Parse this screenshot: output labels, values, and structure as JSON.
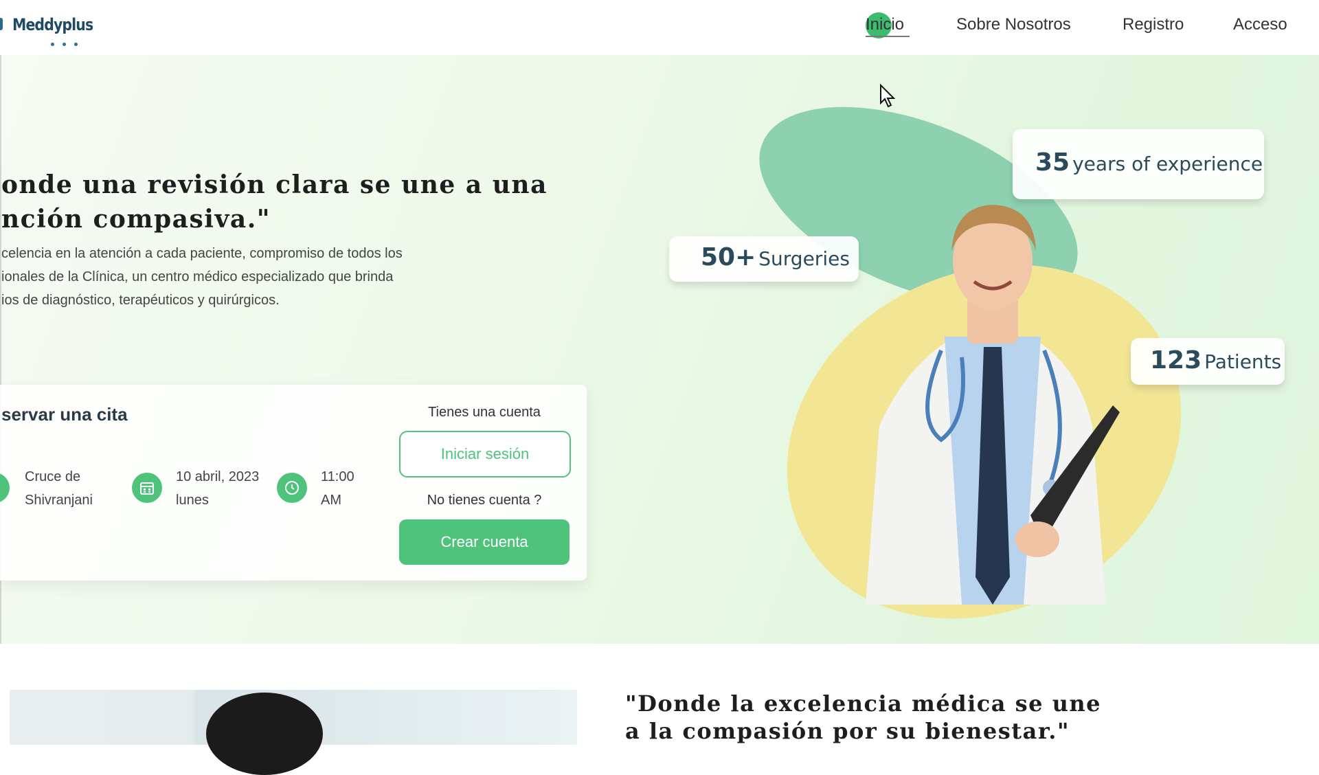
{
  "header": {
    "logo_text": "Meddyplus",
    "nav": [
      {
        "label": "Inicio",
        "active": true
      },
      {
        "label": "Sobre Nosotros"
      },
      {
        "label": "Registro"
      },
      {
        "label": "Acceso"
      }
    ]
  },
  "hero": {
    "title": "onde una revisión clara se une a una\nnción compasiva.\"",
    "description": "celencia en la atención a cada paciente, compromiso de todos los\nionales de la Clínica, un centro médico especializado que brinda\nios de diagnóstico, terapéuticos y quirúrgicos."
  },
  "appointment": {
    "title": "servar una cita",
    "location": "Cruce de\nShivranjani",
    "date": "10 abril, 2023\nlunes",
    "time": "11:00\nAM",
    "has_account_label": "Tienes una cuenta",
    "login_button": "Iniciar sesión",
    "no_account_label": "No tienes cuenta ?",
    "create_button": "Crear cuenta"
  },
  "stats": {
    "experience_number": "35",
    "experience_label": "years of experience",
    "surgeries_number": "50+",
    "surgeries_label": "Surgeries",
    "patients_number": "123",
    "patients_label": "Patients"
  },
  "lower": {
    "quote": "\"Donde la excelencia médica se une\na la compasión por su bienestar.\""
  },
  "colors": {
    "accent": "#4fc27b",
    "brand": "#1f4a66",
    "blob_green": "#8ed1b0",
    "blob_yellow": "#f2e695"
  },
  "icons": {
    "location": "location-pin-icon",
    "date": "calendar-icon",
    "time": "clock-icon"
  }
}
